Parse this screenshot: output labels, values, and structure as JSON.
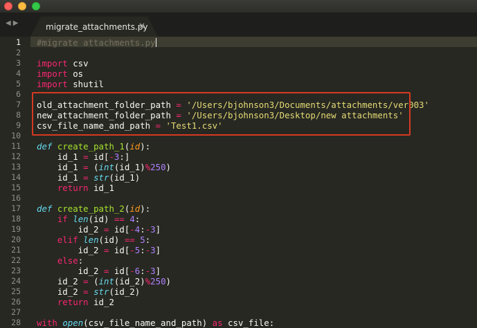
{
  "window": {
    "controls": [
      "close",
      "minimize",
      "maximize"
    ],
    "nav_back": "◀",
    "nav_forward": "▶"
  },
  "tabs": [
    {
      "label": "migrate_attachments.py",
      "close": "×",
      "active": true
    }
  ],
  "editor": {
    "current_line": 1,
    "highlighted_lines": [
      7,
      8,
      9
    ],
    "highlight_color": "#d63a22",
    "lines": [
      {
        "n": 1,
        "tokens": [
          [
            "c",
            "#migrate attachments.py"
          ]
        ]
      },
      {
        "n": 2,
        "tokens": []
      },
      {
        "n": 3,
        "tokens": [
          [
            "k",
            "import"
          ],
          [
            "w",
            " csv"
          ]
        ]
      },
      {
        "n": 4,
        "tokens": [
          [
            "k",
            "import"
          ],
          [
            "w",
            " os"
          ]
        ]
      },
      {
        "n": 5,
        "tokens": [
          [
            "k",
            "import"
          ],
          [
            "w",
            " shutil"
          ]
        ]
      },
      {
        "n": 6,
        "tokens": []
      },
      {
        "n": 7,
        "tokens": [
          [
            "w",
            "old_attachment_folder_path "
          ],
          [
            "k",
            "="
          ],
          [
            "w",
            " "
          ],
          [
            "s",
            "'/Users/bjohnson3/Documents/attachments/ver003'"
          ]
        ]
      },
      {
        "n": 8,
        "tokens": [
          [
            "w",
            "new_attachment_folder_path "
          ],
          [
            "k",
            "="
          ],
          [
            "w",
            " "
          ],
          [
            "s",
            "'/Users/bjohnson3/Desktop/new attachments'"
          ]
        ]
      },
      {
        "n": 9,
        "tokens": [
          [
            "w",
            "csv_file_name_and_path "
          ],
          [
            "k",
            "="
          ],
          [
            "w",
            " "
          ],
          [
            "s",
            "'Test1.csv'"
          ]
        ]
      },
      {
        "n": 10,
        "tokens": []
      },
      {
        "n": 11,
        "tokens": [
          [
            "d",
            "def"
          ],
          [
            "w",
            " "
          ],
          [
            "f",
            "create_path_1"
          ],
          [
            "w",
            "("
          ],
          [
            "p",
            "id"
          ],
          [
            "w",
            "):"
          ]
        ]
      },
      {
        "n": 12,
        "tokens": [
          [
            "w",
            "    id_1 "
          ],
          [
            "k",
            "="
          ],
          [
            "w",
            " id["
          ],
          [
            "k",
            "-"
          ],
          [
            "n",
            "3"
          ],
          [
            "w",
            ":]"
          ]
        ]
      },
      {
        "n": 13,
        "tokens": [
          [
            "w",
            "    id_1 "
          ],
          [
            "k",
            "="
          ],
          [
            "w",
            " ("
          ],
          [
            "b",
            "int"
          ],
          [
            "w",
            "(id_1)"
          ],
          [
            "k",
            "%"
          ],
          [
            "n",
            "250"
          ],
          [
            "w",
            ")"
          ]
        ]
      },
      {
        "n": 14,
        "tokens": [
          [
            "w",
            "    id_1 "
          ],
          [
            "k",
            "="
          ],
          [
            "w",
            " "
          ],
          [
            "b",
            "str"
          ],
          [
            "w",
            "(id_1)"
          ]
        ]
      },
      {
        "n": 15,
        "tokens": [
          [
            "w",
            "    "
          ],
          [
            "k",
            "return"
          ],
          [
            "w",
            " id_1"
          ]
        ]
      },
      {
        "n": 16,
        "tokens": []
      },
      {
        "n": 17,
        "tokens": [
          [
            "d",
            "def"
          ],
          [
            "w",
            " "
          ],
          [
            "f",
            "create_path_2"
          ],
          [
            "w",
            "("
          ],
          [
            "p",
            "id"
          ],
          [
            "w",
            "):"
          ]
        ]
      },
      {
        "n": 18,
        "tokens": [
          [
            "w",
            "    "
          ],
          [
            "k",
            "if"
          ],
          [
            "w",
            " "
          ],
          [
            "b",
            "len"
          ],
          [
            "w",
            "(id) "
          ],
          [
            "k",
            "=="
          ],
          [
            "w",
            " "
          ],
          [
            "n",
            "4"
          ],
          [
            "w",
            ":"
          ]
        ]
      },
      {
        "n": 19,
        "tokens": [
          [
            "w",
            "        id_2 "
          ],
          [
            "k",
            "="
          ],
          [
            "w",
            " id["
          ],
          [
            "k",
            "-"
          ],
          [
            "n",
            "4"
          ],
          [
            "w",
            ":"
          ],
          [
            "k",
            "-"
          ],
          [
            "n",
            "3"
          ],
          [
            "w",
            "]"
          ]
        ]
      },
      {
        "n": 20,
        "tokens": [
          [
            "w",
            "    "
          ],
          [
            "k",
            "elif"
          ],
          [
            "w",
            " "
          ],
          [
            "b",
            "len"
          ],
          [
            "w",
            "(id) "
          ],
          [
            "k",
            "=="
          ],
          [
            "w",
            " "
          ],
          [
            "n",
            "5"
          ],
          [
            "w",
            ":"
          ]
        ]
      },
      {
        "n": 21,
        "tokens": [
          [
            "w",
            "        id_2 "
          ],
          [
            "k",
            "="
          ],
          [
            "w",
            " id["
          ],
          [
            "k",
            "-"
          ],
          [
            "n",
            "5"
          ],
          [
            "w",
            ":"
          ],
          [
            "k",
            "-"
          ],
          [
            "n",
            "3"
          ],
          [
            "w",
            "]"
          ]
        ]
      },
      {
        "n": 22,
        "tokens": [
          [
            "w",
            "    "
          ],
          [
            "k",
            "else"
          ],
          [
            "w",
            ":"
          ]
        ]
      },
      {
        "n": 23,
        "tokens": [
          [
            "w",
            "        id_2 "
          ],
          [
            "k",
            "="
          ],
          [
            "w",
            " id["
          ],
          [
            "k",
            "-"
          ],
          [
            "n",
            "6"
          ],
          [
            "w",
            ":"
          ],
          [
            "k",
            "-"
          ],
          [
            "n",
            "3"
          ],
          [
            "w",
            "]"
          ]
        ]
      },
      {
        "n": 24,
        "tokens": [
          [
            "w",
            "    id_2 "
          ],
          [
            "k",
            "="
          ],
          [
            "w",
            " ("
          ],
          [
            "b",
            "int"
          ],
          [
            "w",
            "(id_2)"
          ],
          [
            "k",
            "%"
          ],
          [
            "n",
            "250"
          ],
          [
            "w",
            ")"
          ]
        ]
      },
      {
        "n": 25,
        "tokens": [
          [
            "w",
            "    id_2 "
          ],
          [
            "k",
            "="
          ],
          [
            "w",
            " "
          ],
          [
            "b",
            "str"
          ],
          [
            "w",
            "(id_2)"
          ]
        ]
      },
      {
        "n": 26,
        "tokens": [
          [
            "w",
            "    "
          ],
          [
            "k",
            "return"
          ],
          [
            "w",
            " id_2"
          ]
        ]
      },
      {
        "n": 27,
        "tokens": []
      },
      {
        "n": 28,
        "tokens": [
          [
            "k",
            "with"
          ],
          [
            "w",
            " "
          ],
          [
            "b",
            "open"
          ],
          [
            "w",
            "(csv_file_name_and_path) "
          ],
          [
            "k",
            "as"
          ],
          [
            "w",
            " csv_file:"
          ]
        ]
      }
    ]
  }
}
